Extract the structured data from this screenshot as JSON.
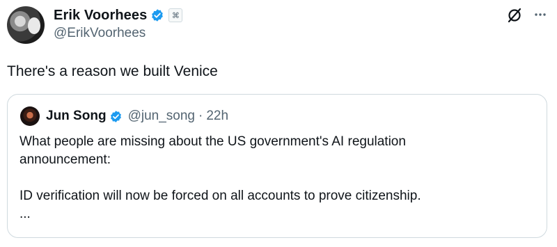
{
  "post": {
    "author": {
      "display_name": "Erik Voorhees",
      "handle": "@ErikVoorhees",
      "verified": true,
      "affiliation_badge_icon": "affiliation-badge-icon"
    },
    "text": "There's a reason we built Venice",
    "actions": {
      "grok_icon": "grok-icon",
      "more_icon": "more-icon"
    }
  },
  "quote": {
    "author": {
      "display_name": "Jun Song",
      "handle": "@jun_song",
      "verified": true
    },
    "separator": "·",
    "time": "22h",
    "lines": [
      "What people are missing about the US government's AI regulation",
      "announcement:",
      "ID verification will now be forced on all accounts to prove citizenship.",
      "..."
    ]
  },
  "colors": {
    "text": "#0f1419",
    "secondary": "#536471",
    "verified_blue": "#1d9bf0",
    "border": "#cfd9de"
  }
}
